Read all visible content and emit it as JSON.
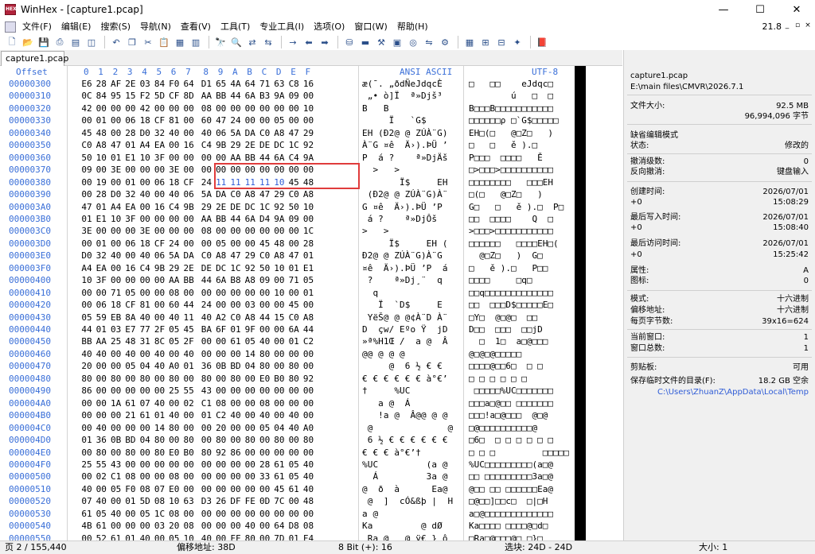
{
  "title": "WinHex - [capture1.pcap]",
  "window_buttons": {
    "minimize": "—",
    "maximize": "☐",
    "close": "✕"
  },
  "menu": [
    "文件(F)",
    "编辑(E)",
    "搜索(S)",
    "导航(N)",
    "查看(V)",
    "工具(T)",
    "专业工具(I)",
    "选项(O)",
    "窗口(W)",
    "帮助(H)"
  ],
  "version": "21.8",
  "mdi_buttons": [
    "_",
    "▫",
    "×"
  ],
  "toolbar_icons": [
    "new-file",
    "open",
    "save",
    "print",
    "properties",
    "open-disk",
    "undo",
    "copy",
    "cut",
    "paste",
    "paste-block",
    "clipboard",
    "find",
    "find-hex",
    "replace",
    "replace-hex",
    "go-to-offset",
    "jump-back",
    "jump-forward",
    "disk",
    "ram",
    "tools",
    "calculator",
    "analyze",
    "compare",
    "gear",
    "table",
    "charset",
    "views",
    "bookmark",
    "help-book"
  ],
  "tab": "capture1.pcap",
  "hex_header": {
    "offset": "Offset",
    "cols": [
      "0",
      "1",
      "2",
      "3",
      "4",
      "5",
      "6",
      "7",
      "8",
      "9",
      "A",
      "B",
      "C",
      "D",
      "E",
      "F"
    ],
    "ansi": "ANSI ASCII",
    "utf": "UTF-8"
  },
  "rows": [
    {
      "o": "00000300",
      "b": "E6 28 AF 2E 03 84 F0 64 D1 65 4A 64 71 63 C8 16",
      "a": "æ(¯. „ðdÑeJdqcÈ",
      "u": "□   □□    eJdqc□"
    },
    {
      "o": "00000310",
      "b": "0C 84 95 15 F2 5D CF 8D AA BB 44 6A B3 9A 09 00",
      "a": " „• ò]Ï  ª»Djš³",
      "u": "        ú   □  □"
    },
    {
      "o": "00000320",
      "b": "42 00 00 00 42 00 00 00 08 00 00 00 00 00 00 10",
      "a": "B   B           ",
      "u": "B□□□B□□□□□□□□□□□"
    },
    {
      "o": "00000330",
      "b": "00 01 00 06 18 CF 81 00 60 47 24 00 00 05 00 00",
      "a": "     Ï   `G$    ",
      "u": "□□□□□□ρ □`G$□□□□□"
    },
    {
      "o": "00000340",
      "b": "45 48 00 28 D0 32 40 00 40 06 5A DA C0 A8 47 29",
      "a": "EH (Ð2@ @ ZÚÀ¨G)",
      "u": "EH□(□   @□Z□   )"
    },
    {
      "o": "00000350",
      "b": "C0 A8 47 01 A4 EA 00 16 C4 9B 29 2E DE DC 1C 92",
      "a": "À¨G ¤ê  Ä›).ÞÜ ’",
      "u": "□   □   ě ).□   "
    },
    {
      "o": "00000360",
      "b": "50 10 01 E1 10 3F 00 00 00 00 AA BB 44 6A C4 9A",
      "a": "P  á ?    ª»DjÄš",
      "u": "P□□□  □□□□   Ě  "
    },
    {
      "o": "00000370",
      "b": "09 00 3E 00 00 00 3E 00 00 00 00 00 00 00 00 00",
      "a": "  >   >         ",
      "u": "□>□□□>□□□□□□□□□□"
    },
    {
      "o": "00000380",
      "b": "00 19 00 01 00 06 18 CF 24 11 11 11 11 10 45 48",
      "a": "       Ï$     EH",
      "u": "□□□□□□□□   □□□EH"
    },
    {
      "o": "00000390",
      "b": "00 28 D0 32 40 00 40 06 5A DA C0 A8 47 29 C0 A8",
      "a": " (Ð2@ @ ZÚÀ¨G)À¨",
      "u": "□(□   @□Z□   )  "
    },
    {
      "o": "000003A0",
      "b": "47 01 A4 EA 00 16 C4 9B 29 2E DE DC 1C 92 50 10",
      "a": "G ¤ê  Ä›).ÞÜ ’P ",
      "u": "G□   □   ě ).□  P□"
    },
    {
      "o": "000003B0",
      "b": "01 E1 10 3F 00 00 00 00 AA BB 44 6A D4 9A 09 00",
      "a": " á ?    ª»DjÔš  ",
      "u": "□□  □□□□    Q  □"
    },
    {
      "o": "000003C0",
      "b": "3E 00 00 00 3E 00 00 00 08 00 00 00 00 00 00 1C",
      "a": ">   >           ",
      "u": ">□□□>□□□□□□□□□□□"
    },
    {
      "o": "000003D0",
      "b": "00 01 00 06 18 CF 24 00 00 05 00 00 45 48 00 28",
      "a": "     Ï$     EH (",
      "u": "□□□□□□   □□□□EH□("
    },
    {
      "o": "000003E0",
      "b": "D0 32 40 00 40 06 5A DA C0 A8 47 29 C0 A8 47 01",
      "a": "Ð2@ @ ZÚÀ¨G)À¨G ",
      "u": "  @□Z□   )  G□   "
    },
    {
      "o": "000003F0",
      "b": "A4 EA 00 16 C4 9B 29 2E DE DC 1C 92 50 10 01 E1",
      "a": "¤ê  Ä›).ÞÜ ’P  á",
      "u": "□   ě ).□   P□□  "
    },
    {
      "o": "00000400",
      "b": "10 3F 00 00 00 00 AA BB 44 6A B8 A8 09 00 71 05",
      "a": " ?    ª»Dj¸¨  q ",
      "u": "□□□□     □q□"
    },
    {
      "o": "00000410",
      "b": "00 00 71 05 00 00 08 00 00 00 00 00 00 10 00 01",
      "a": "  q             ",
      "u": "□□q□□□□□□□□□□□□□"
    },
    {
      "o": "00000420",
      "b": "00 06 18 CF 81 00 60 44 24 00 00 03 00 00 45 00",
      "a": "   Ï  `D$     E ",
      "u": "□□  □□□D$□□□□□E□"
    },
    {
      "o": "00000430",
      "b": "05 59 EB 8A 40 00 40 11 40 A2 C0 A8 44 15 C0 A8",
      "a": " YëŠ@ @ @¢À¨D À¨",
      "u": "□Y□  @□@□  □□  "
    },
    {
      "o": "00000440",
      "b": "44 01 03 E7 77 2F 05 45 BA 6F 01 9F 00 00 6A 44",
      "a": "D  çw/ Eºo Ÿ  jD",
      "u": "D□□  □□□  □□jD"
    },
    {
      "o": "00000450",
      "b": "BB AA 25 48 31 8C 05 2F 00 00 61 05 40 00 01 C2",
      "a": "»ª%H1Œ /  a @  Â",
      "u": "  □  1□  a□@□□□"
    },
    {
      "o": "00000460",
      "b": "40 40 00 40 00 40 00 40 00 00 00 14 80 00 00 00",
      "a": "@@ @ @ @        ",
      "u": "@□@□@□□□□□"
    },
    {
      "o": "00000470",
      "b": "20 00 00 05 04 40 A0 01 36 0B BD 04 80 00 80 00",
      "a": "     @  6 ½ € € ",
      "u": "□□□□@□□6□  □ □"
    },
    {
      "o": "00000480",
      "b": "80 00 80 00 80 00 80 00 80 00 80 00 E0 B0 80 92",
      "a": "€ € € € € € à°€’",
      "u": "□ □ □ □ □ □      "
    },
    {
      "o": "00000490",
      "b": "86 00 00 00 00 00 25 55 43 00 00 00 00 00 00 00",
      "a": "†     %UC       ",
      "u": " □□□□□%UC□□□□□□□"
    },
    {
      "o": "000004A0",
      "b": "00 00 1A 61 07 40 00 02 C1 08 00 00 08 00 00 00",
      "a": "   a @  Á       ",
      "u": "□□□a□@□□ □□□□□□□"
    },
    {
      "o": "000004B0",
      "b": "00 00 00 21 61 01 40 00 01 C2 40 00 40 00 40 00",
      "a": "   !a @  Â@@ @ @",
      "u": "□□□!a□@□□□  @□@"
    },
    {
      "o": "000004C0",
      "b": "00 40 00 00 00 14 80 00 00 20 00 00 05 04 40 A0",
      "a": " @              @",
      "u": "□@□□□□□□□□□□@"
    },
    {
      "o": "000004D0",
      "b": "01 36 0B BD 04 80 00 80 00 80 00 80 00 80 00 80",
      "a": " 6 ½ € € € € € €",
      "u": "□6□  □ □ □ □ □ □"
    },
    {
      "o": "000004E0",
      "b": "00 80 00 80 00 80 E0 B0 80 92 86 00 00 00 00 00",
      "a": "€ € € à°€’†     ",
      "u": "□ □ □         □□□□□"
    },
    {
      "o": "000004F0",
      "b": "25 55 43 00 00 00 00 00 00 00 00 00 28 61 05 40",
      "a": "%UC         (a @",
      "u": "%UC□□□□□□□□□(a□@"
    },
    {
      "o": "00000500",
      "b": "00 02 C1 08 00 00 08 00 00 00 00 00 33 61 05 40",
      "a": "  Á         3a @",
      "u": "□□ □□□□□□□□□3a□@"
    },
    {
      "o": "00000510",
      "b": "40 00 05 F0 08 07 E0 00 00 00 00 00 00 45 61 40",
      "a": "@  ð  à      Ea@",
      "u": "@□□ □□ □□□□□□Ea@"
    },
    {
      "o": "00000520",
      "b": "07 40 00 01 5D 08 10 63 D3 26 DF FE 0D 7C 00 48",
      "a": " @  ]  cÓ&ßþ |  H",
      "u": "□@□□]□□c□  □|□H"
    },
    {
      "o": "00000530",
      "b": "61 05 40 00 05 1C 08 00 00 00 00 00 00 00 00 00",
      "a": "a @             ",
      "u": "a□@□□□□□□□□□□□□□"
    },
    {
      "o": "00000540",
      "b": "4B 61 00 00 00 03 20 08 00 00 00 40 00 64 D8 08",
      "a": "Ka         @ dØ ",
      "u": "Ka□□□□ □□□□@□d□"
    },
    {
      "o": "00000550",
      "b": "00 52 61 01 40 00 05 10 40 00 FF 80 00 7D 01 F4",
      "a": " Ra @   @ ÿ€ } ô",
      "u": "□Ra□@□□□@□ □}□ "
    },
    {
      "o": "00000560",
      "b": "00 00 00 00 2A 14 50 00 75 30 75 30 00 00 00 06",
      "a": "    * P u0u0    ",
      "u": "□□□□*□P□u0u0□□□□"
    }
  ],
  "info": {
    "filename": "capture1.pcap",
    "path": "E:\\main files\\CMVR\\2026.7.1",
    "size_label": "文件大小:",
    "size_mb": "92.5 MB",
    "size_bytes": "96,994,096 字节",
    "default_edit": "缺省编辑模式",
    "state_label": "状态:",
    "state": "修改的",
    "undo_label": "撤消级数:",
    "undo": "0",
    "redo_label": "反向撤消:",
    "redo": "键盘输入",
    "created_label": "创建时间:",
    "created_date": "2026/07/01",
    "created_tz": "+0",
    "created_time": "15:08:29",
    "written_label": "最后写入时间:",
    "written_date": "2026/07/01",
    "written_tz": "+0",
    "written_time": "15:08:40",
    "access_label": "最后访问时间:",
    "access_date": "2026/07/01",
    "access_tz": "+0",
    "access_time": "15:25:42",
    "attr_label": "属性:",
    "attr": "A",
    "icon_label": "图标:",
    "icon": "0",
    "mode_label": "模式:",
    "mode": "十六进制",
    "offset_label": "偏移地址:",
    "offset": "十六进制",
    "bpp_label": "每页字节数:",
    "bpp": "39x16=624",
    "curwin_label": "当前窗口:",
    "curwin": "1",
    "totalwin_label": "窗口总数:",
    "totalwin": "1",
    "clip_label": "剪贴板:",
    "clip": "可用",
    "temp_label": "保存临时文件的目录(F):",
    "temp_free": "18.2 GB 空余",
    "temp_path": "C:\\Users\\ZhuanZ\\AppData\\Local\\Temp"
  },
  "status": {
    "page": "页 2 / 155,440",
    "offset": "偏移地址: 38D",
    "value": "8 Bit (+): 16",
    "selection": "选块: 24D - 24D",
    "size": "大小: 1"
  }
}
